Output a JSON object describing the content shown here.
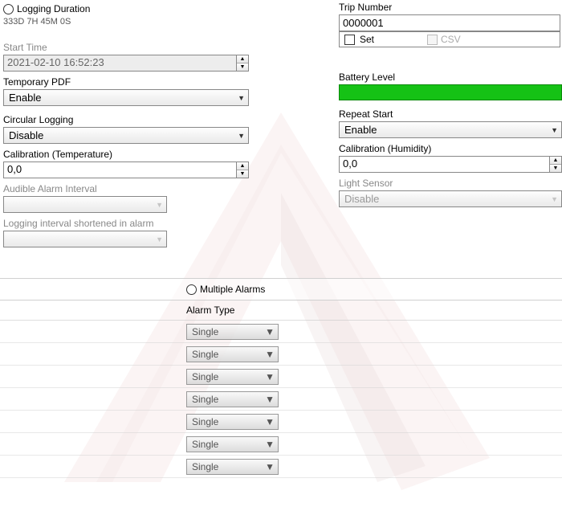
{
  "left": {
    "logging_duration_label": "Logging Duration",
    "logging_duration_value": "333D 7H 45M 0S",
    "start_time_label": "Start Time",
    "start_time_value": "2021-02-10 16:52:23",
    "temp_pdf_label": "Temporary PDF",
    "temp_pdf_value": "Enable",
    "circular_label": "Circular Logging",
    "circular_value": "Disable",
    "calib_temp_label": "Calibration (Temperature)",
    "calib_temp_value": "0,0",
    "audible_label": "Audible Alarm Interval",
    "audible_value": "",
    "shorten_label": "Logging interval shortened in alarm",
    "shorten_value": ""
  },
  "right": {
    "trip_number_label": "Trip Number",
    "trip_number_value": "0000001",
    "set_label": "Set",
    "csv_label": "CSV",
    "battery_label": "Battery Level",
    "repeat_label": "Repeat Start",
    "repeat_value": "Enable",
    "calib_hum_label": "Calibration (Humidity)",
    "calib_hum_value": "0,0",
    "light_label": "Light Sensor",
    "light_value": "Disable"
  },
  "alarms": {
    "multiple_label": "Multiple Alarms",
    "type_header": "Alarm Type",
    "rows": [
      {
        "value": "Single"
      },
      {
        "value": "Single"
      },
      {
        "value": "Single"
      },
      {
        "value": "Single"
      },
      {
        "value": "Single"
      },
      {
        "value": "Single"
      },
      {
        "value": "Single"
      }
    ]
  }
}
